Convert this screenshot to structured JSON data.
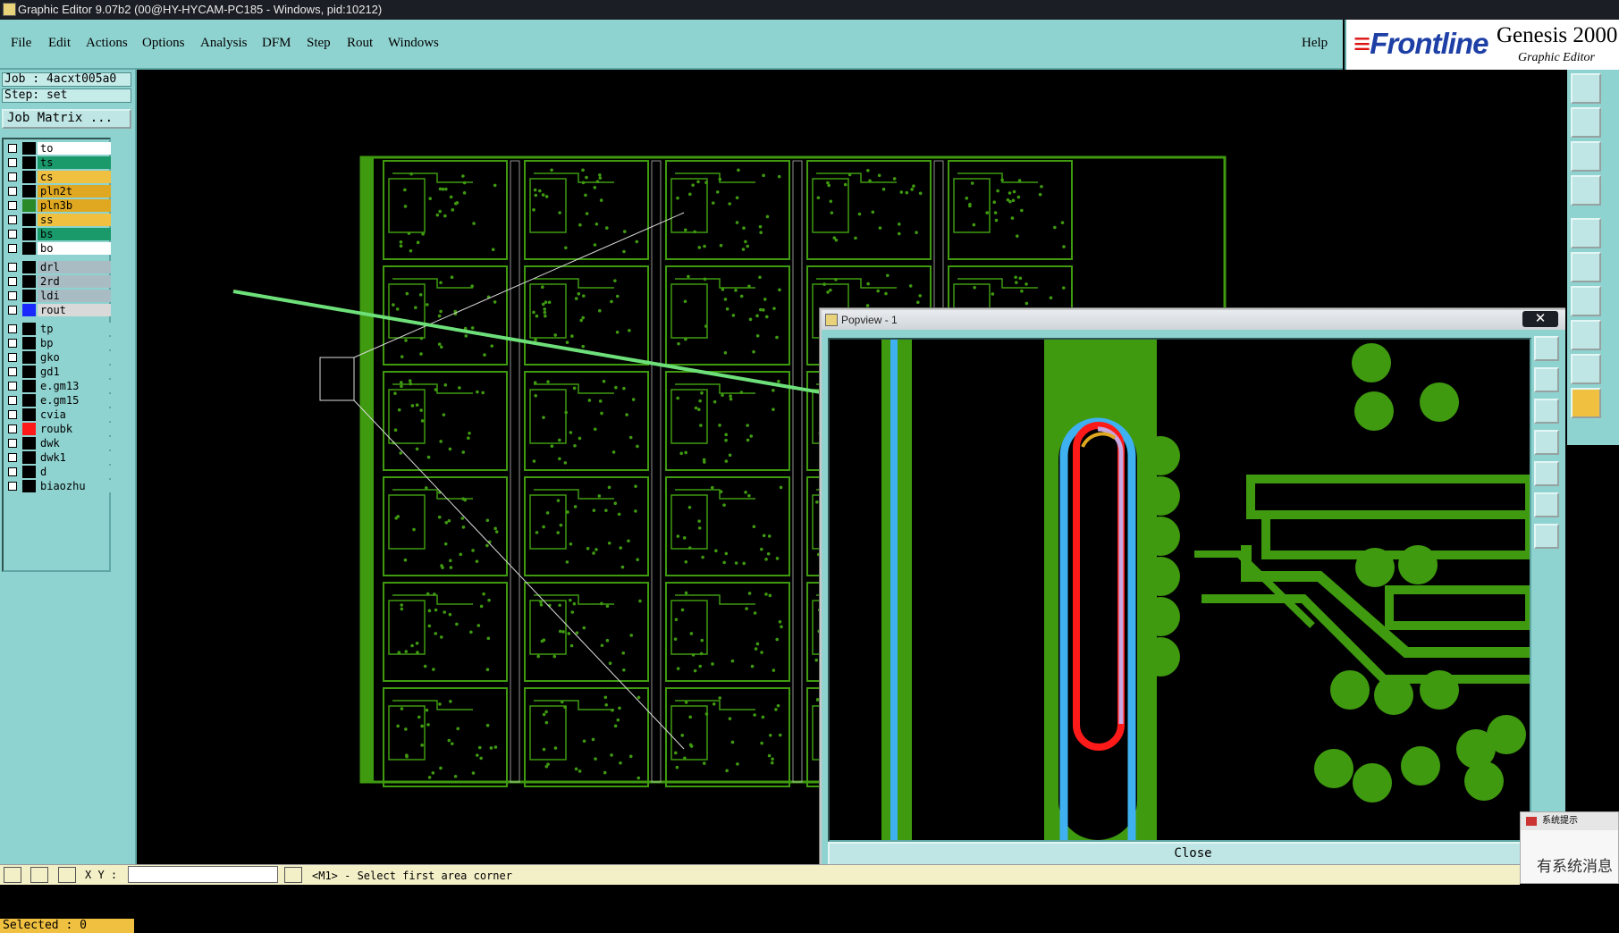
{
  "window": {
    "title": "Graphic Editor 9.07b2 (00@HY-HYCAM-PC185 - Windows, pid:10212)"
  },
  "menu": {
    "items": [
      "File",
      "Edit",
      "Actions",
      "Options",
      "Analysis",
      "DFM",
      "Step",
      "Rout",
      "Windows"
    ],
    "help": "Help"
  },
  "brand": {
    "logo": "Frontline",
    "product": "Genesis 2000",
    "subtitle": "Graphic Editor"
  },
  "job": {
    "job_line": "Job : 4acxt005a0",
    "step_line": "Step: set",
    "matrix_button": "Job Matrix ..."
  },
  "layers": [
    {
      "name": "to",
      "color": "#ffffff",
      "swatch": "#000000"
    },
    {
      "name": "ts",
      "color": "#1a9a6a",
      "swatch": "#000000"
    },
    {
      "name": "cs",
      "color": "#f0c040",
      "swatch": "#000000"
    },
    {
      "name": "pln2t",
      "color": "#e0a820",
      "swatch": "#000000"
    },
    {
      "name": "pln3b",
      "color": "#e0a820",
      "swatch": "#2a8a2a"
    },
    {
      "name": "ss",
      "color": "#f0c040",
      "swatch": "#000000"
    },
    {
      "name": "bs",
      "color": "#1a9a6a",
      "swatch": "#000000"
    },
    {
      "name": "bo",
      "color": "#ffffff",
      "swatch": "#000000"
    },
    {
      "name": "drl",
      "color": "#a9bcc4",
      "swatch": "#000000"
    },
    {
      "name": "2rd",
      "color": "#a9bcc4",
      "swatch": "#000000"
    },
    {
      "name": "ldi",
      "color": "#a9bcc4",
      "swatch": "#000000"
    },
    {
      "name": "rout",
      "color": "#d9d9d9",
      "swatch": "#1a2aff"
    },
    {
      "name": "tp",
      "color": "#8fd3d0",
      "swatch": "#000000"
    },
    {
      "name": "bp",
      "color": "#8fd3d0",
      "swatch": "#000000"
    },
    {
      "name": "gko",
      "color": "#8fd3d0",
      "swatch": "#000000"
    },
    {
      "name": "gd1",
      "color": "#8fd3d0",
      "swatch": "#000000"
    },
    {
      "name": "e.gm13",
      "color": "#8fd3d0",
      "swatch": "#000000"
    },
    {
      "name": "e.gm15",
      "color": "#8fd3d0",
      "swatch": "#000000"
    },
    {
      "name": "cvia",
      "color": "#8fd3d0",
      "swatch": "#000000"
    },
    {
      "name": "roubk",
      "color": "#8fd3d0",
      "swatch": "#ff1a1a"
    },
    {
      "name": "dwk",
      "color": "#8fd3d0",
      "swatch": "#000000"
    },
    {
      "name": "dwk1",
      "color": "#8fd3d0",
      "swatch": "#000000"
    },
    {
      "name": "d",
      "color": "#8fd3d0",
      "swatch": "#000000"
    },
    {
      "name": "biaozhu",
      "color": "#8fd3d0",
      "swatch": "#000000"
    }
  ],
  "status": {
    "selected": "Selected : 0",
    "xy_label": "X Y :",
    "xy_value": "",
    "message": "<M1> - Select first area corner"
  },
  "popview": {
    "title": "Popview - 1",
    "close_x": "✕",
    "close_label": "Close"
  },
  "system_tip": {
    "title": "系统提示",
    "body": "有系统消息"
  },
  "colors": {
    "panel": "#8fd3d0",
    "board_green": "#3f9a10",
    "rout_blue": "#3fb0f0",
    "rout_red": "#ff1a1a",
    "arrow": "#6ee07a"
  }
}
